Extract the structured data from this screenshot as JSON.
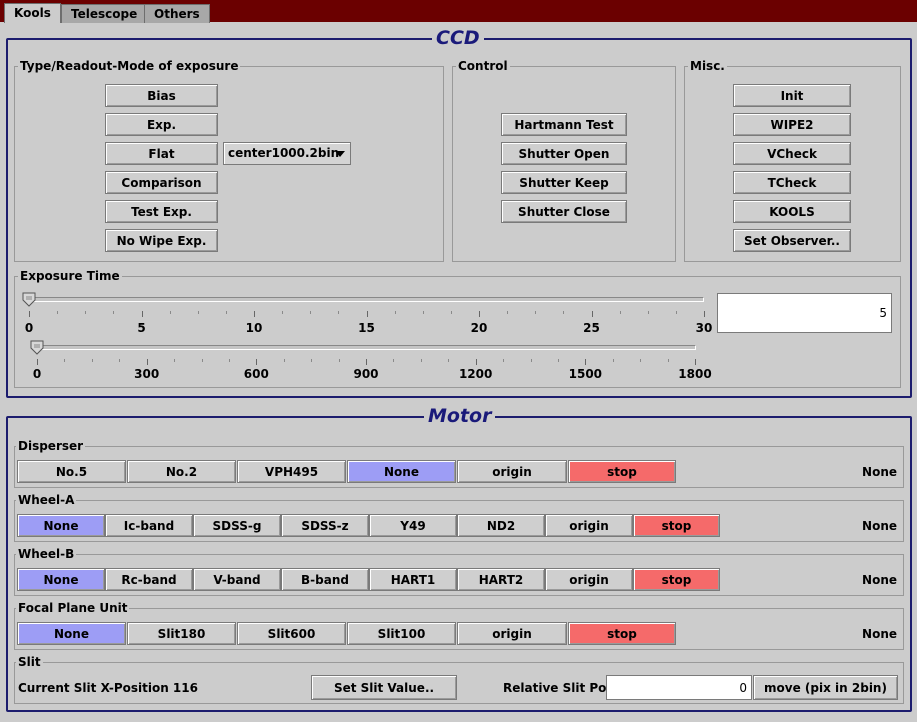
{
  "tabs": [
    "Kools",
    "Telescope",
    "Others"
  ],
  "ccd": {
    "title": "CCD",
    "type_group": {
      "title": "Type/Readout-Mode of exposure",
      "buttons": [
        "Bias",
        "Exp.",
        "Flat",
        "Comparison",
        "Test Exp.",
        "No Wipe Exp."
      ],
      "flat_option": "center1000.2bin"
    },
    "control_group": {
      "title": "Control",
      "buttons": [
        "Hartmann Test",
        "Shutter Open",
        "Shutter Keep",
        "Shutter Close"
      ]
    },
    "misc_group": {
      "title": "Misc.",
      "buttons": [
        "Init",
        "WIPE2",
        "VCheck",
        "TCheck",
        "KOOLS",
        "Set Observer.."
      ]
    },
    "exposure": {
      "title": "Exposure Time",
      "value": "5",
      "slider1": {
        "labels": [
          "0",
          "5",
          "10",
          "15",
          "20",
          "25",
          "30"
        ],
        "value": 0
      },
      "slider2": {
        "labels": [
          "0",
          "300",
          "600",
          "900",
          "1200",
          "1500",
          "1800"
        ],
        "value": 0
      }
    }
  },
  "motor": {
    "title": "Motor",
    "disperser": {
      "title": "Disperser",
      "buttons": [
        "No.5",
        "No.2",
        "VPH495",
        "None",
        "origin",
        "stop"
      ],
      "status": "None"
    },
    "wheel_a": {
      "title": "Wheel-A",
      "buttons": [
        "None",
        "Ic-band",
        "SDSS-g",
        "SDSS-z",
        "Y49",
        "ND2",
        "origin",
        "stop"
      ],
      "status": "None"
    },
    "wheel_b": {
      "title": "Wheel-B",
      "buttons": [
        "None",
        "Rc-band",
        "V-band",
        "B-band",
        "HART1",
        "HART2",
        "origin",
        "stop"
      ],
      "status": "None"
    },
    "fpu": {
      "title": "Focal Plane Unit",
      "buttons": [
        "None",
        "Slit180",
        "Slit600",
        "Slit100",
        "origin",
        "stop"
      ],
      "status": "None"
    },
    "slit": {
      "title": "Slit",
      "position_text": "Current Slit X-Position 116",
      "set_button": "Set Slit Value..",
      "relative_label": "Relative Slit Pos.",
      "relative_value": "0",
      "move_button": "move (pix in 2bin)"
    }
  },
  "colors": {
    "selected": "#9d9df5",
    "stop": "#f56a6a",
    "tabbar": "#6b0000",
    "title": "#1a1a7a"
  }
}
